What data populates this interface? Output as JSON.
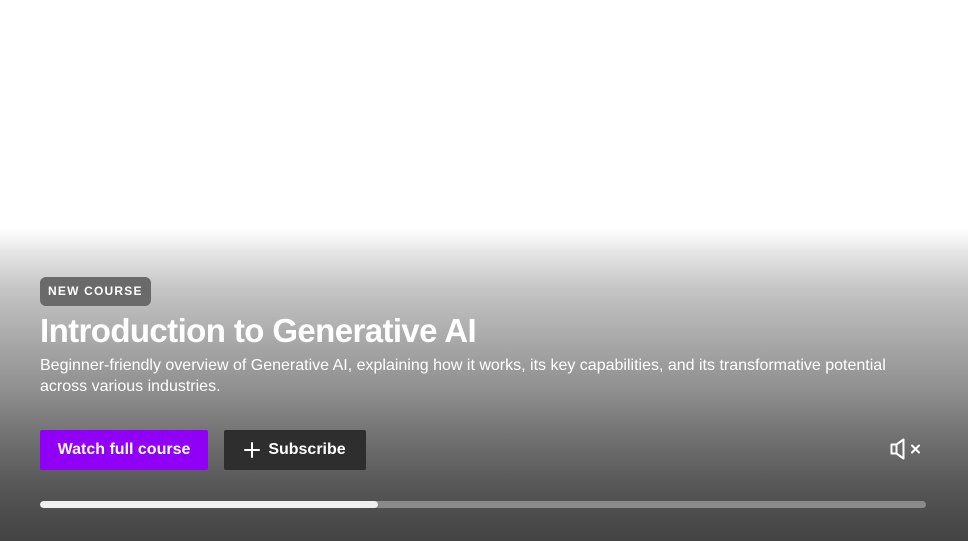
{
  "hero": {
    "badge": "NEW COURSE",
    "title": "Introduction to Generative AI",
    "description": "Beginner-friendly overview of Generative AI, explaining how it works, its key capabilities, and its transformative potential across various industries.",
    "watch_label": "Watch full course",
    "subscribe_label": "Subscribe",
    "subscribe_icon": "plus-icon",
    "mute_icon": "speaker-muted-icon",
    "progress": 0.382,
    "colors": {
      "accent": "#9100f6",
      "secondary_button": "#2e2e2e",
      "badge_bg": "#6a6a6a",
      "text": "#ffffff",
      "progress_fill": "#f0f0f0",
      "progress_track": "#8a8a8a"
    }
  }
}
